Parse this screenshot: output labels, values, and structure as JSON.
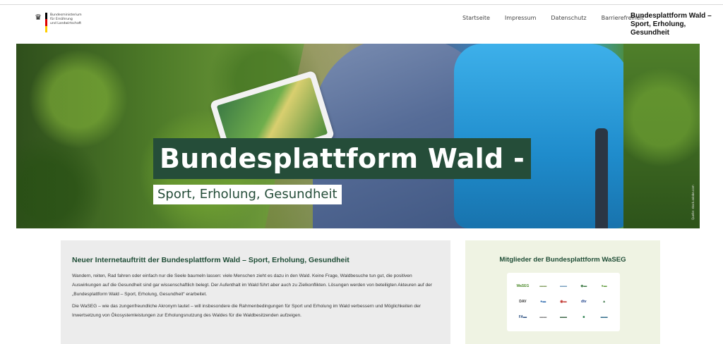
{
  "header": {
    "ministry_lines": [
      "Bundesministerium",
      "für Ernährung",
      "und Landwirtschaft"
    ],
    "nav": [
      {
        "label": "Startseite"
      },
      {
        "label": "Impressum"
      },
      {
        "label": "Datenschutz"
      },
      {
        "label": "Barrierefreiheit"
      }
    ],
    "site_title_line1": "Bundesplattform Wald –",
    "site_title_line2": "Sport, Erholung, Gesundheit",
    "colors": {
      "flag_black": "#000000",
      "flag_red": "#dd0000",
      "flag_gold": "#ffce00"
    }
  },
  "hero": {
    "title": "Bundesplattform Wald -",
    "subtitle": "Sport, Erholung, Gesundheit",
    "credit": "Quelle: stock.adobe.com",
    "colors": {
      "title_bg": "#254d39",
      "title_text": "#ffffff",
      "subtitle_text": "#254d39"
    }
  },
  "news": {
    "heading": "Neuer Internetauftritt der Bundesplattform Wald – Sport, Erholung, Gesundheit",
    "paragraph1": "Wandern, reiten, Rad fahren oder einfach nur die Seele baumeln lassen: viele Menschen zieht es dazu in den Wald. Keine Frage, Waldbesuche tun gut, die positiven Auswirkungen auf die Gesundheit sind gar wissenschaftlich belegt. Der Aufenthalt im Wald führt aber auch zu Zielkonflikten. Lösungen werden von beteiligten Akteuren auf der „Bundesplattform Wald – Sport, Erholung, Gesundheit“ erarbeitet.",
    "paragraph2": "Die WaSEG – wie das zungenfreundliche Akronym lautet – will insbesondere die Rahmenbedingungen für Sport und Erholung im Wald verbessern und Möglichkeiten der Inwertsetzung von Ökosystemleistungen zur Erholungsnutzung des Waldes für die Waldbesitzenden aufzeigen."
  },
  "members": {
    "heading": "Mitglieder der Bundesplattform WaSEG",
    "logos": [
      {
        "label": "WaSEG",
        "color": "#4c8a2b"
      },
      {
        "label": "▬▬",
        "color": "#8aa36a"
      },
      {
        "label": "▬▬",
        "color": "#7aa0c0"
      },
      {
        "label": "◆▬",
        "color": "#3d7a45"
      },
      {
        "label": "●▬",
        "color": "#5f9a3a"
      },
      {
        "label": "DAV",
        "color": "#333333"
      },
      {
        "label": "●▬",
        "color": "#1f5fa8"
      },
      {
        "label": "◉▬",
        "color": "#c0302a"
      },
      {
        "label": "dtv",
        "color": "#1b3f8a"
      },
      {
        "label": "▲",
        "color": "#2e6b3a"
      },
      {
        "label": "FA▬",
        "color": "#2b4f80"
      },
      {
        "label": "▬▬",
        "color": "#888888"
      },
      {
        "label": "▬▬",
        "color": "#3f6a4a"
      },
      {
        "label": "■",
        "color": "#1f7a45"
      },
      {
        "label": "▬▬",
        "color": "#2e6b8a"
      }
    ]
  }
}
